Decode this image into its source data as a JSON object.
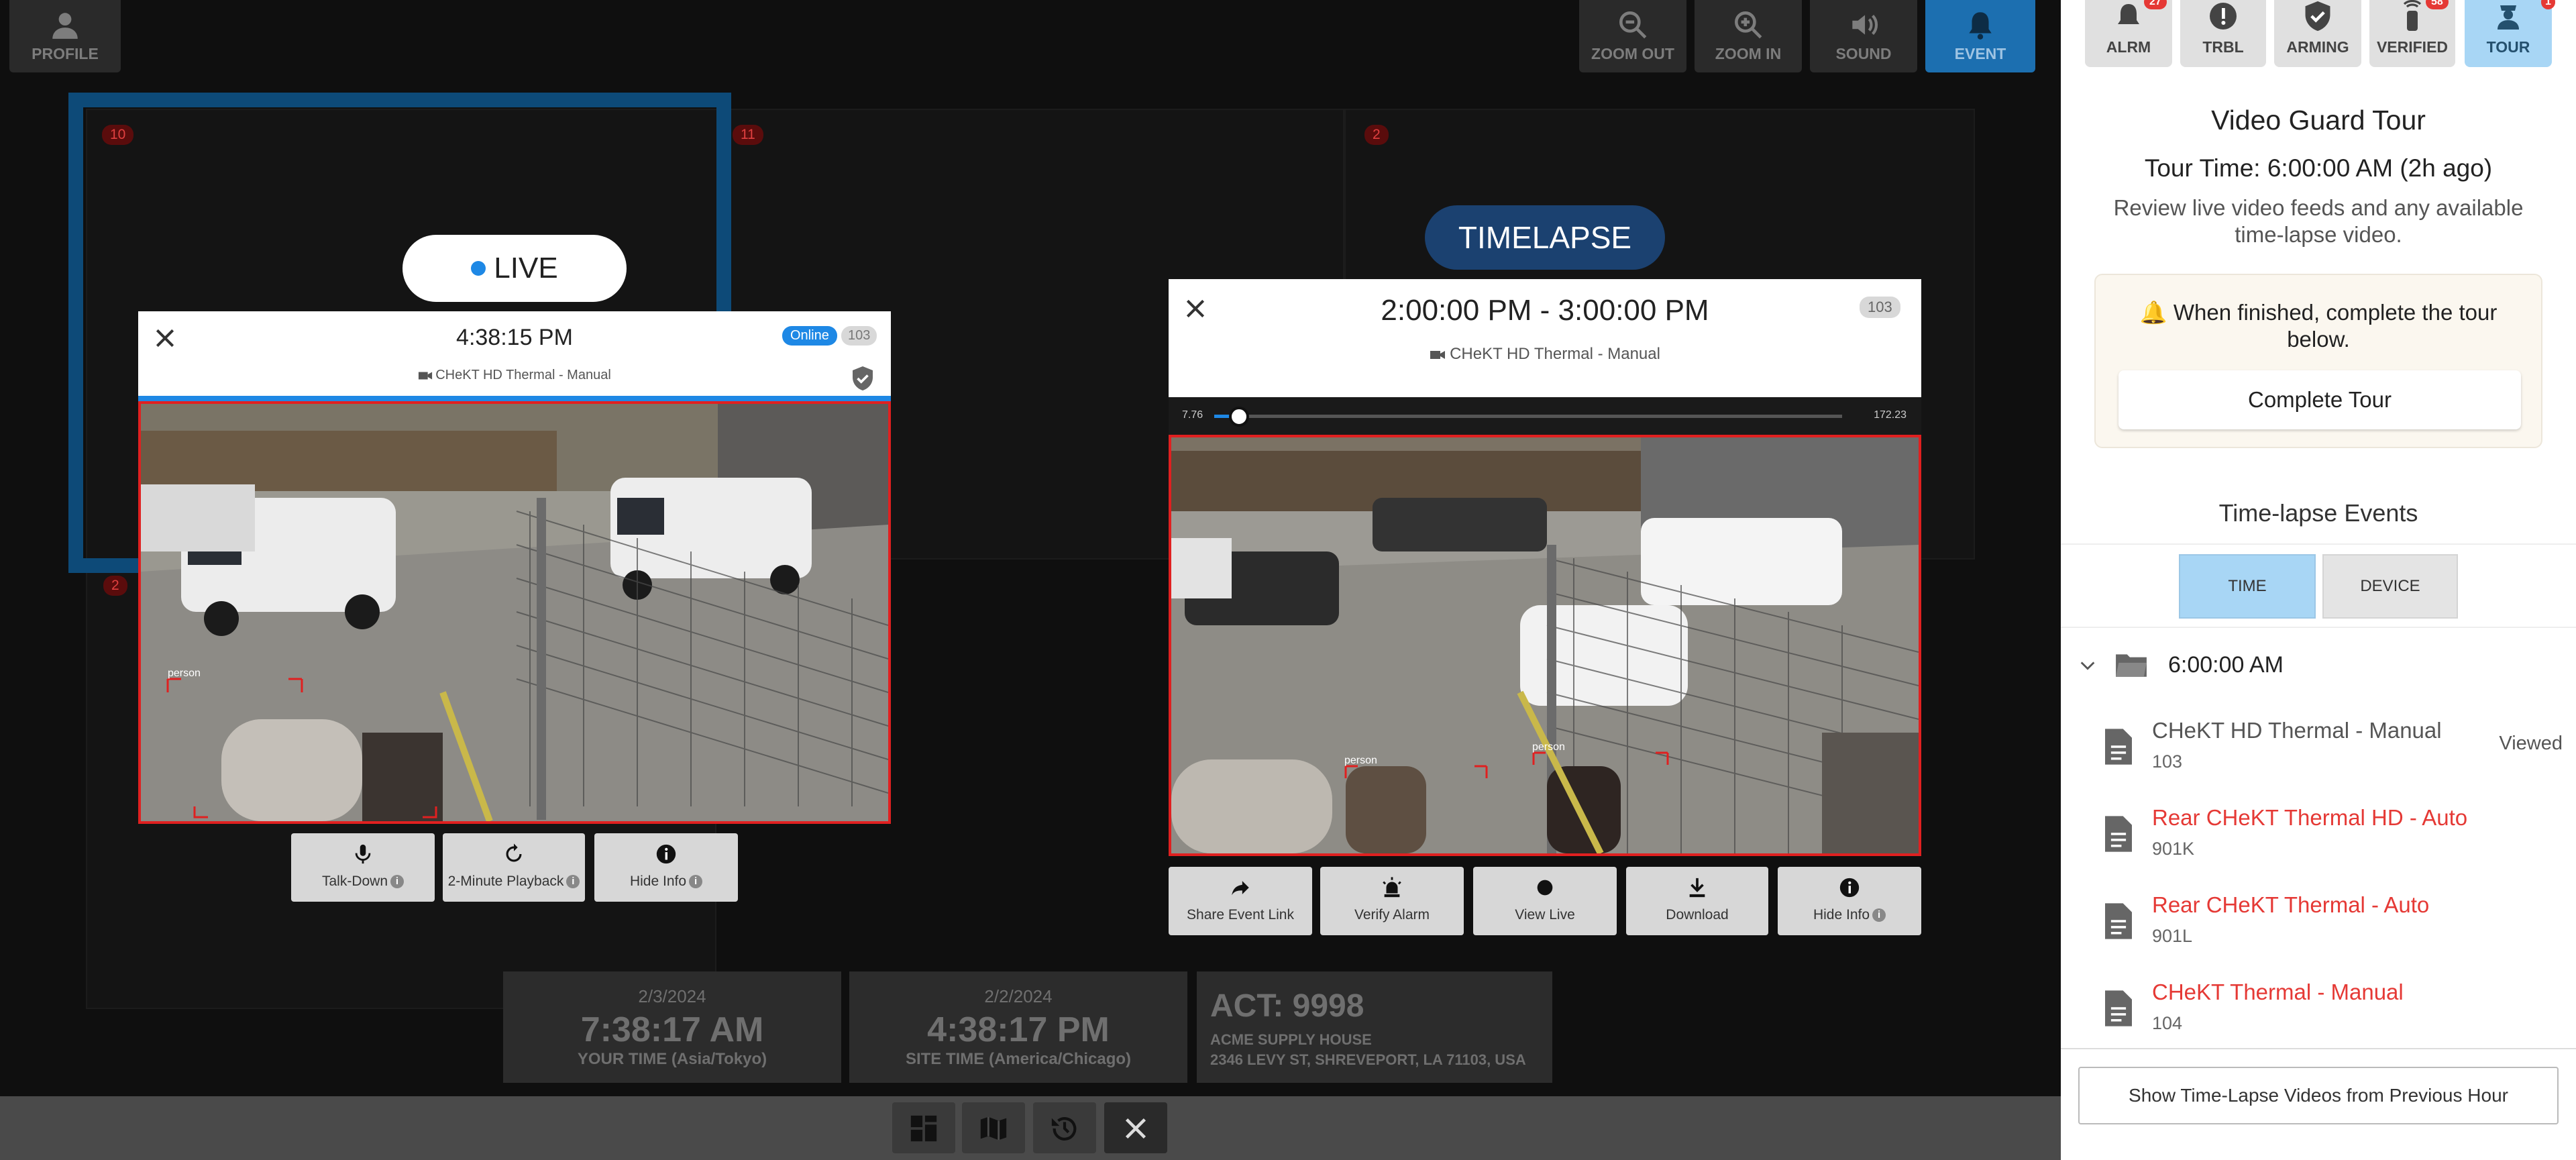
{
  "toolbar": {
    "profile": "PROFILE",
    "zoom_out": "ZOOM OUT",
    "zoom_in": "ZOOM IN",
    "sound": "SOUND",
    "event": "EVENT"
  },
  "grid": {
    "cells": [
      "10",
      "11",
      "2",
      "2"
    ]
  },
  "live_badge": "LIVE",
  "timelapse_badge": "TIMELAPSE",
  "live_panel": {
    "time": "4:38:15 PM",
    "status": "Online",
    "device_num": "103",
    "camera": "CHeKT HD Thermal - Manual",
    "detection_label": "person",
    "buttons": [
      "Talk-Down",
      "2-Minute Playback",
      "Hide Info"
    ]
  },
  "timelapse_panel": {
    "range": "2:00:00 PM - 3:00:00 PM",
    "device_num": "103",
    "camera": "CHeKT HD Thermal - Manual",
    "progress_start": "7.76",
    "progress_end": "172.23",
    "progress_value": 0.04,
    "detection_labels": [
      "person",
      "person"
    ],
    "buttons": [
      "Share Event Link",
      "Verify Alarm",
      "View Live",
      "Download",
      "Hide Info"
    ]
  },
  "clocks": [
    {
      "date": "2/3/2024",
      "time": "7:38:17 AM",
      "label": "YOUR TIME (Asia/Tokyo)"
    },
    {
      "date": "2/2/2024",
      "time": "4:38:17 PM",
      "label": "SITE TIME (America/Chicago)"
    }
  ],
  "account": {
    "title": "ACT: 9998",
    "name": "ACME SUPPLY HOUSE",
    "address": "2346 LEVY ST, SHREVEPORT, LA 71103, USA"
  },
  "right_panel": {
    "tabs": [
      "ALRM",
      "TRBL",
      "ARMING",
      "VERIFIED",
      "TOUR"
    ],
    "tab_counts": [
      "27",
      "",
      "",
      "58",
      "1"
    ],
    "title": "Video Guard Tour",
    "tour_time": "Tour Time: 6:00:00 AM (2h ago)",
    "description": "Review live video feeds and any available time-lapse video.",
    "notice": "When finished, complete the tour below.",
    "complete_button": "Complete Tour",
    "events_title": "Time-lapse Events",
    "toggle": [
      "TIME",
      "DEVICE"
    ],
    "folder": "6:00:00 AM",
    "events": [
      {
        "name": "CHeKT HD Thermal - Manual",
        "id": "103",
        "status": "Viewed",
        "color": "#555555"
      },
      {
        "name": "Rear CHeKT Thermal HD - Auto",
        "id": "901K",
        "status": "",
        "color": "#e53935"
      },
      {
        "name": "Rear CHeKT Thermal - Auto",
        "id": "901L",
        "status": "",
        "color": "#e53935"
      },
      {
        "name": "CHeKT Thermal - Manual",
        "id": "104",
        "status": "",
        "color": "#e53935"
      }
    ],
    "footer_button": "Show Time-Lapse Videos from Previous Hour"
  },
  "colors": {
    "accent": "#1c6fb0",
    "alert": "#e53935",
    "tour_active": "#a8d6f5"
  }
}
